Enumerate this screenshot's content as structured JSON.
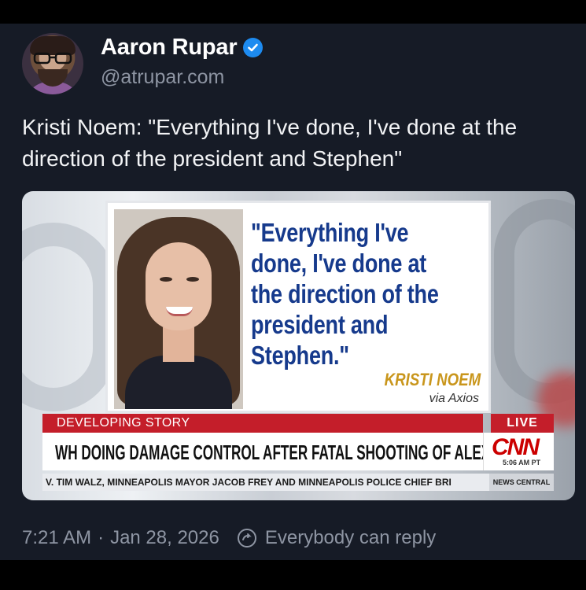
{
  "author": {
    "name": "Aaron Rupar",
    "handle": "@atrupar.com"
  },
  "post": {
    "text": "Kristi Noem: \"Everything I've done, I've done at the direction of the president and Stephen\""
  },
  "media": {
    "quote": "\"Everything I've done, I've done at the direction of the president and Stephen.\"",
    "attribution_name": "KRISTI NOEM",
    "attribution_source": "via Axios",
    "developing_label": "DEVELOPING STORY",
    "live_label": "LIVE",
    "headline": "WH DOING DAMAGE CONTROL AFTER FATAL SHOOTING OF ALEX PRETTI",
    "network_logo": "CNN",
    "broadcast_time": "5:06 AM PT",
    "ticker": "V. TIM WALZ, MINNEAPOLIS MAYOR JACOB FREY AND MINNEAPOLIS POLICE CHIEF BRI",
    "ticker_brand": "NEWS CENTRAL"
  },
  "footer": {
    "time": "7:21 AM",
    "separator": "·",
    "date": "Jan 28, 2026",
    "reply_setting": "Everybody can reply"
  },
  "colors": {
    "background": "#161b26",
    "verified": "#1d8bf0",
    "cnn_red": "#c41e2a",
    "quote_blue": "#163a8c",
    "attribution_gold": "#c9961c"
  },
  "icons": [
    "verified-badge-icon",
    "reply-settings-icon"
  ]
}
